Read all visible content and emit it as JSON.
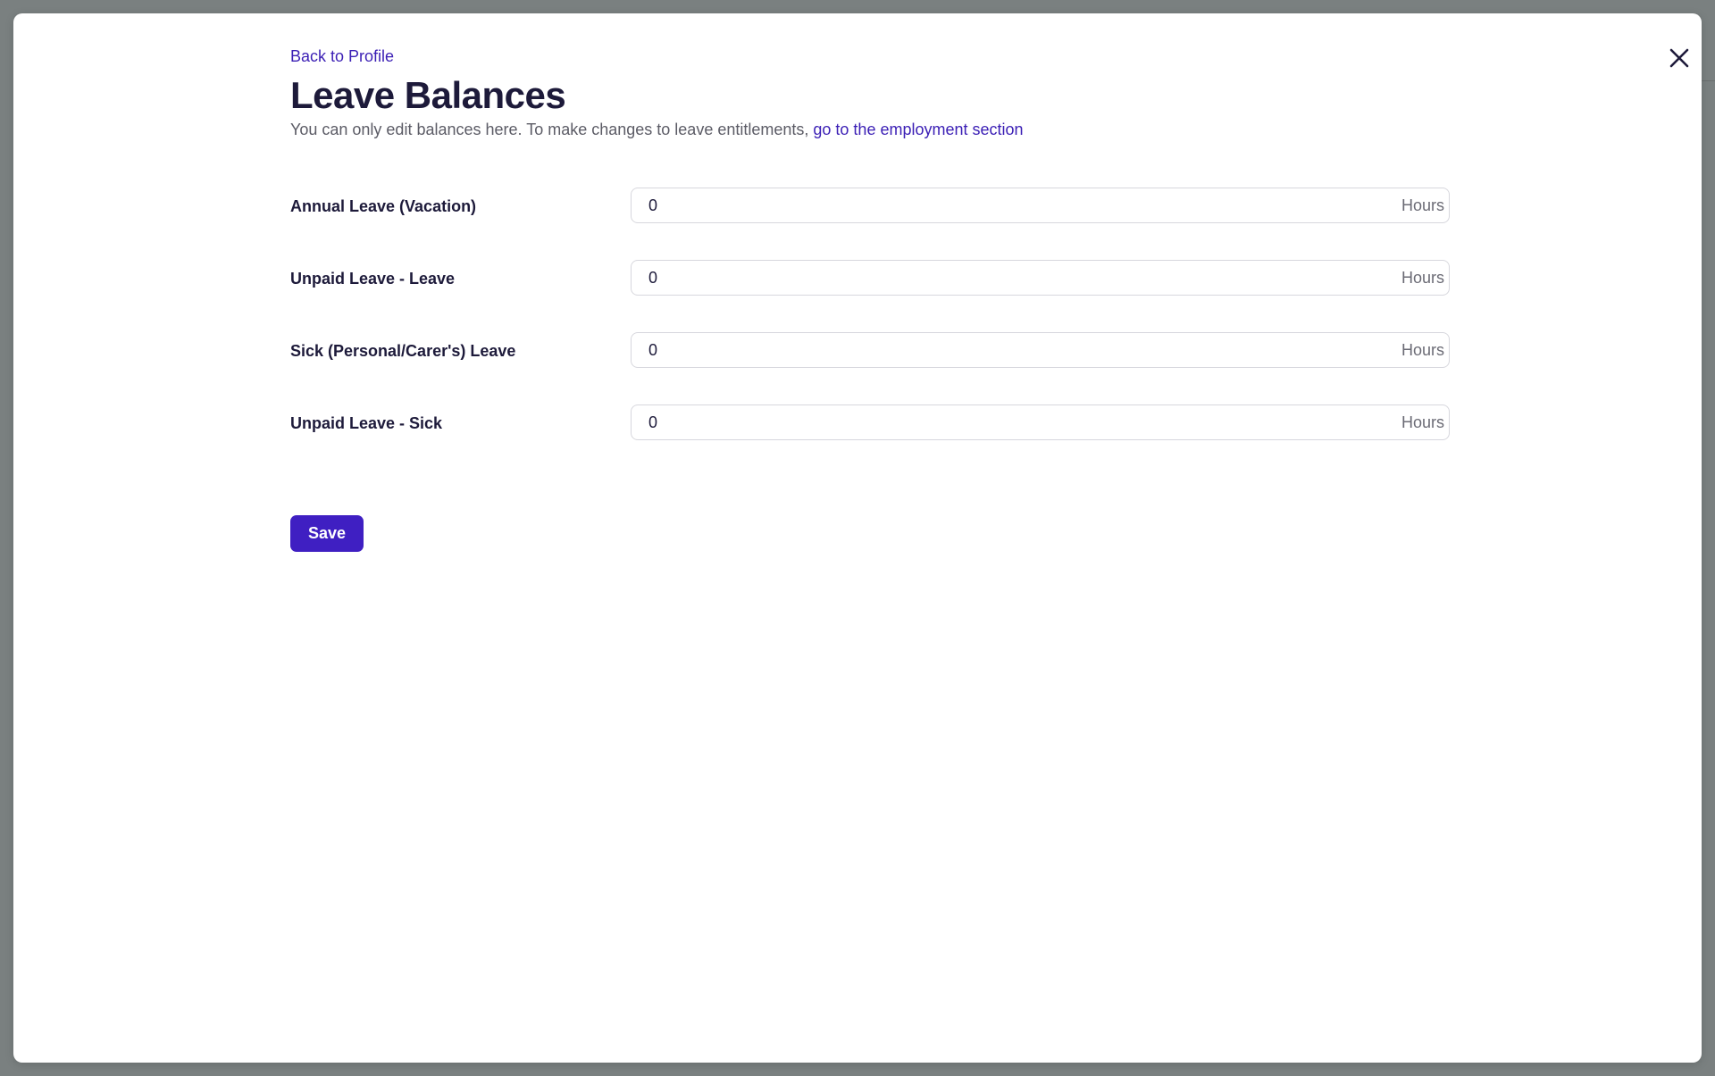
{
  "header": {
    "back_link": "Back to Profile",
    "title": "Leave Balances",
    "subtitle_text": "You can only edit balances here. To make changes to leave entitlements, ",
    "subtitle_link": "go to the employment section"
  },
  "form": {
    "rows": [
      {
        "label": "Annual Leave (Vacation)",
        "value": "0",
        "unit": "Hours"
      },
      {
        "label": "Unpaid Leave - Leave",
        "value": "0",
        "unit": "Hours"
      },
      {
        "label": "Sick (Personal/Carer's) Leave",
        "value": "0",
        "unit": "Hours"
      },
      {
        "label": "Unpaid Leave - Sick",
        "value": "0",
        "unit": "Hours"
      }
    ],
    "save_label": "Save"
  },
  "icons": {
    "close": "close-icon"
  },
  "colors": {
    "accent": "#3f1fc2",
    "link": "#3b1fb5",
    "title": "#1d1a3a",
    "overlay": "#7a8080"
  }
}
